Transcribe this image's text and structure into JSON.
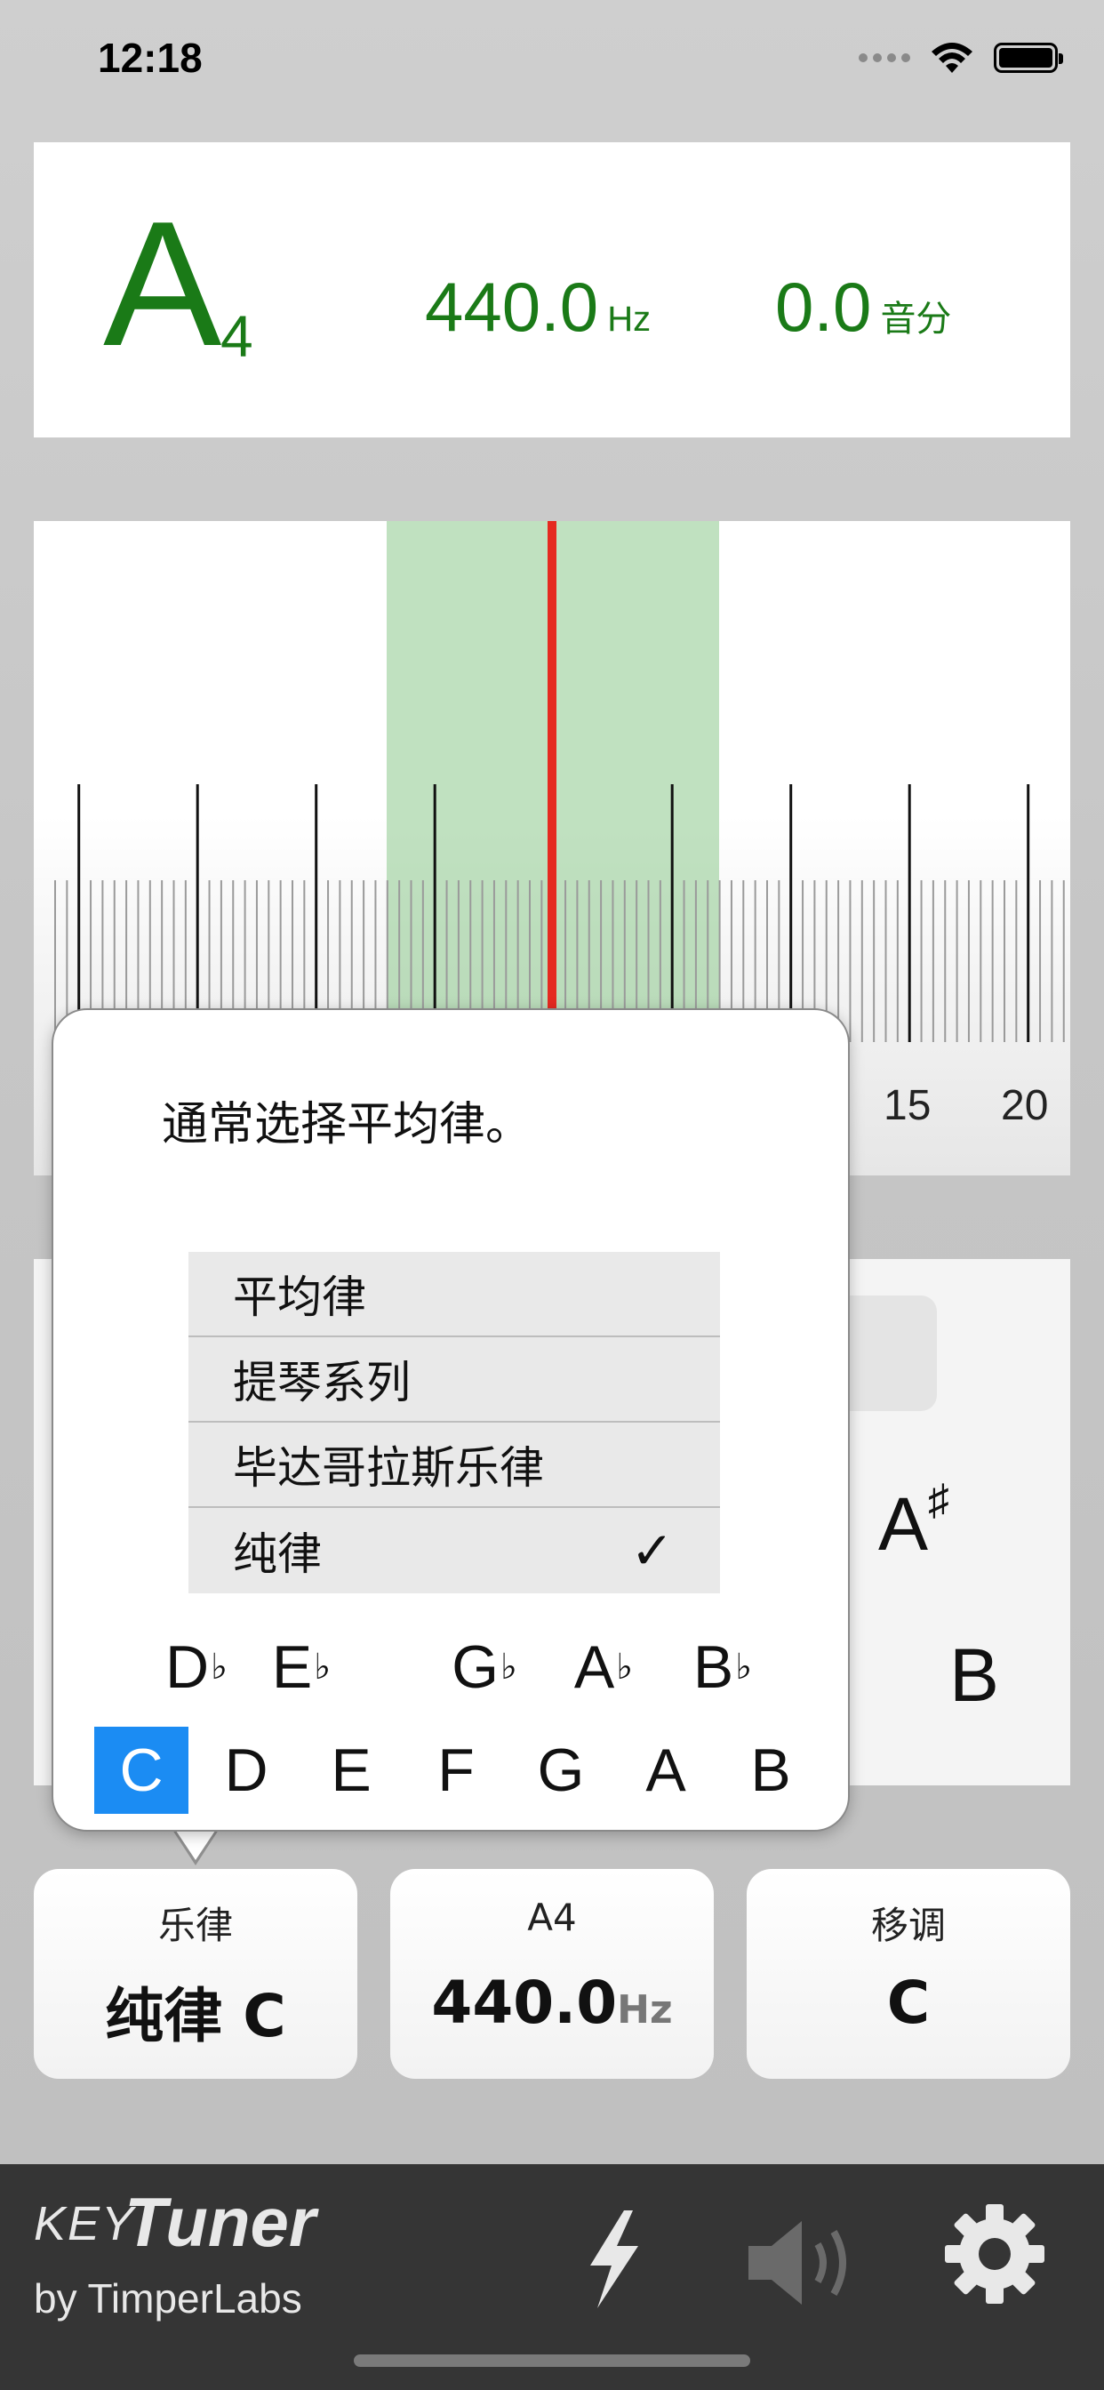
{
  "status": {
    "time": "12:18"
  },
  "note": {
    "name": "A",
    "octave": "4",
    "frequency": "440.0",
    "frequency_unit": "Hz",
    "cents": "0.0",
    "cents_unit": "音分"
  },
  "meter": {
    "labels": [
      "15",
      "20"
    ],
    "needle_cents": 0
  },
  "key_panel": {
    "sharp_key": "A",
    "sharp_symbol": "♯",
    "natural_key": "B"
  },
  "popup": {
    "hint": "通常选择平均律。",
    "temperaments": [
      {
        "label": "平均律",
        "checked": false
      },
      {
        "label": "提琴系列",
        "checked": false
      },
      {
        "label": "毕达哥拉斯乐律",
        "checked": false
      },
      {
        "label": "纯律",
        "checked": true
      }
    ],
    "flat_keys": [
      {
        "letter": "D",
        "accidental": "♭"
      },
      {
        "letter": "E",
        "accidental": "♭"
      },
      {
        "letter": "G",
        "accidental": "♭"
      },
      {
        "letter": "A",
        "accidental": "♭"
      },
      {
        "letter": "B",
        "accidental": "♭"
      }
    ],
    "natural_keys": [
      "C",
      "D",
      "E",
      "F",
      "G",
      "A",
      "B"
    ],
    "selected_key": "C"
  },
  "cards": {
    "temperament": {
      "label": "乐律",
      "value": "纯律 C"
    },
    "a4": {
      "label": "A4",
      "value": "440.0",
      "unit": "Hz"
    },
    "transpose": {
      "label": "移调",
      "value": "C"
    }
  },
  "brand": {
    "key": "KEY",
    "tuner": "Tuner",
    "by": "by TimperLabs"
  },
  "colors": {
    "note_green": "#1a7a17",
    "needle_red": "#e52a20",
    "selected_blue": "#1b8cf3",
    "bar_dark": "#353535"
  }
}
